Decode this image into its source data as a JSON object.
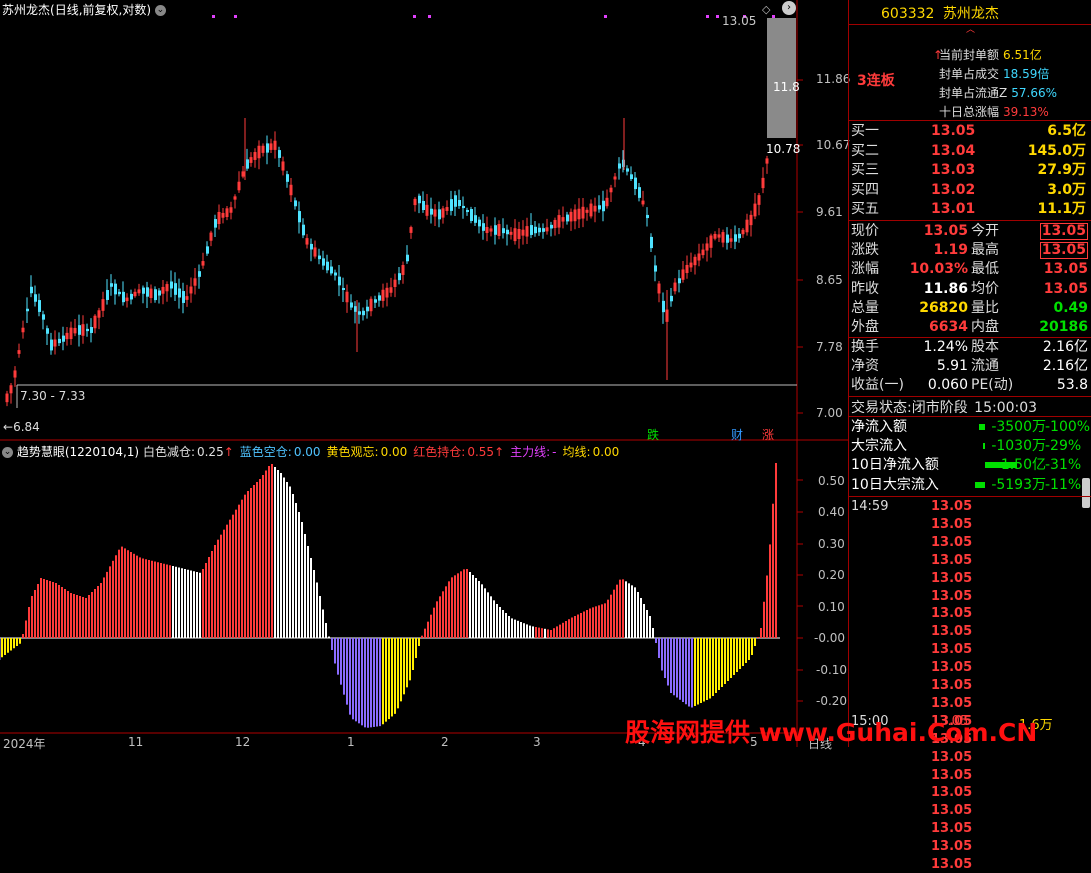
{
  "header": {
    "title": "苏州龙杰",
    "params": "(日线,前复权,对数)",
    "top_right_price": "13.05"
  },
  "price_axis": [
    "11.86",
    "10.67",
    "9.61",
    "8.65",
    "7.78",
    "7.00"
  ],
  "price_box": {
    "high_label": "11.8",
    "low_label": "10.78"
  },
  "range_label": "7.30 - 7.33",
  "low_label": "6.84",
  "event_tags": [
    {
      "text": "跌",
      "color": "#00e000"
    },
    {
      "text": "财",
      "color": "#3399ff"
    },
    {
      "text": "涨",
      "color": "#ff3b3b"
    }
  ],
  "indicator": {
    "name": "趋势慧眼",
    "params": "(1220104,1)",
    "items": [
      {
        "label": "白色减仓:",
        "value": "0.25",
        "arrow": "↑",
        "color": "#e0e0e0",
        "arrow_color": "#ff3b3b"
      },
      {
        "label": "蓝色空仓:",
        "value": "0.00",
        "arrow": "",
        "color": "#4fc3ff",
        "arrow_color": ""
      },
      {
        "label": "黄色观忘:",
        "value": "0.00",
        "arrow": "",
        "color": "#ffd800",
        "arrow_color": ""
      },
      {
        "label": "红色持仓:",
        "value": "0.55",
        "arrow": "↑",
        "color": "#ff3b3b",
        "arrow_color": "#ff3b3b"
      },
      {
        "label": "主力线:",
        "value": "-",
        "arrow": "",
        "color": "#e040fb",
        "arrow_color": ""
      },
      {
        "label": "均线:",
        "value": "0.00",
        "arrow": "",
        "color": "#ffd800",
        "arrow_color": ""
      }
    ],
    "axis": [
      "0.50",
      "0.40",
      "0.30",
      "0.20",
      "0.10",
      "-0.00",
      "-0.10",
      "-0.20"
    ]
  },
  "x_axis": [
    "2024年",
    "11",
    "12",
    "1",
    "2",
    "3",
    "4",
    "5"
  ],
  "x_axis_mode": "日线",
  "watermark": "股海网提供 www.Guhai.Com.CN",
  "right_panel": {
    "code": "603332",
    "name": "苏州龙杰",
    "streak": "3连板",
    "seal_info": [
      {
        "label": "当前封单额",
        "value": "6.51亿",
        "color": "#ffd800",
        "arrow": "↑"
      },
      {
        "label": "封单占成交",
        "value": "18.59倍",
        "color": "#3fd8ff",
        "arrow": ""
      },
      {
        "label": "封单占流通Z",
        "value": "57.66%",
        "color": "#3fd8ff",
        "arrow": ""
      },
      {
        "label": "十日总涨幅",
        "value": "39.13%",
        "color": "#ff3b3b",
        "arrow": ""
      }
    ],
    "bids": [
      {
        "label": "买一",
        "price": "13.05",
        "vol": "6.5亿"
      },
      {
        "label": "买二",
        "price": "13.04",
        "vol": "145.0万"
      },
      {
        "label": "买三",
        "price": "13.03",
        "vol": "27.9万"
      },
      {
        "label": "买四",
        "price": "13.02",
        "vol": "3.0万"
      },
      {
        "label": "买五",
        "price": "13.01",
        "vol": "11.1万"
      }
    ],
    "quote": [
      {
        "l1": "现价",
        "v1": "13.05",
        "c1": "#ff3b3b",
        "l2": "今开",
        "v2": "13.05",
        "c2": "#ff3b3b",
        "box": true
      },
      {
        "l1": "涨跌",
        "v1": "1.19",
        "c1": "#ff3b3b",
        "l2": "最高",
        "v2": "13.05",
        "c2": "#ff3b3b",
        "box": true
      },
      {
        "l1": "涨幅",
        "v1": "10.03%",
        "c1": "#ff3b3b",
        "l2": "最低",
        "v2": "13.05",
        "c2": "#ff3b3b",
        "box": false
      },
      {
        "l1": "昨收",
        "v1": "11.86",
        "c1": "#ffffff",
        "l2": "均价",
        "v2": "13.05",
        "c2": "#ff3b3b",
        "box": false
      },
      {
        "l1": "总量",
        "v1": "26820",
        "c1": "#ffd800",
        "l2": "量比",
        "v2": "0.49",
        "c2": "#00e000",
        "box": false
      },
      {
        "l1": "外盘",
        "v1": "6634",
        "c1": "#ff3b3b",
        "l2": "内盘",
        "v2": "20186",
        "c2": "#00e000",
        "box": false
      }
    ],
    "stats": [
      {
        "l1": "换手",
        "v1": "1.24%",
        "l2": "股本",
        "v2": "2.16亿"
      },
      {
        "l1": "净资",
        "v1": "5.91",
        "l2": "流通",
        "v2": "2.16亿"
      },
      {
        "l1": "收益(一)",
        "v1": "0.060",
        "l2": "PE(动)",
        "v2": "53.8"
      }
    ],
    "trade_state": {
      "label": "交易状态:",
      "value": "闭市阶段",
      "time": "15:00:03"
    },
    "flows": [
      {
        "label": "净流入额",
        "value": "-3500万",
        "pct": "-100%",
        "bar": 6
      },
      {
        "label": "大宗流入",
        "value": "-1030万",
        "pct": "-29%",
        "bar": 2
      },
      {
        "label": "10日净流入额",
        "value": "-1.50亿",
        "pct": "-31%",
        "bar": 32
      },
      {
        "label": "10日大宗流入",
        "value": "-5193万",
        "pct": "-11%",
        "bar": 10
      }
    ],
    "ticks": [
      {
        "time": "14:59",
        "price": "13.05"
      },
      {
        "time": "",
        "price": "13.05"
      },
      {
        "time": "",
        "price": "13.05"
      },
      {
        "time": "",
        "price": "13.05"
      },
      {
        "time": "",
        "price": "13.05"
      },
      {
        "time": "",
        "price": "13.05"
      },
      {
        "time": "",
        "price": "13.05"
      },
      {
        "time": "",
        "price": "13.05"
      },
      {
        "time": "",
        "price": "13.05"
      },
      {
        "time": "",
        "price": "13.05"
      },
      {
        "time": "",
        "price": "13.05"
      },
      {
        "time": "",
        "price": "13.05"
      },
      {
        "time": "",
        "price": "13.05"
      },
      {
        "time": "",
        "price": "13.05"
      },
      {
        "time": "",
        "price": "13.05"
      },
      {
        "time": "",
        "price": "13.05"
      },
      {
        "time": "",
        "price": "13.05"
      },
      {
        "time": "",
        "price": "13.05"
      },
      {
        "time": "",
        "price": "13.05"
      },
      {
        "time": "",
        "price": "13.05"
      },
      {
        "time": "",
        "price": "13.05"
      }
    ],
    "bottom_tick": {
      "time": "15:00",
      "price": "13.05",
      "vol": "1.6万"
    }
  },
  "colors": {
    "up": "#ff3b3b",
    "down": "#4fe3ff",
    "frame": "#b00000",
    "fall": "#8a6bff",
    "warn": "#ffee00",
    "fade": "#ffffff"
  }
}
